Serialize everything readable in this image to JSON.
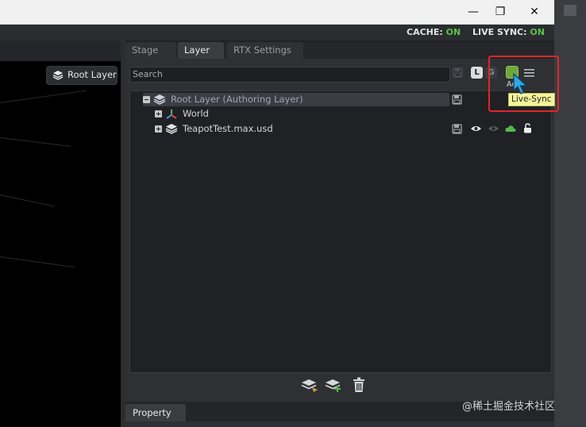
{
  "window": {
    "minimize": "—",
    "restore": "❐",
    "close": "✕"
  },
  "status": {
    "cache_label": "CACHE:",
    "cache_value": "ON",
    "livesync_label": "LIVE SYNC:",
    "livesync_value": "ON"
  },
  "viewport": {
    "root_layer_label": "Root Layer"
  },
  "tabs": [
    {
      "label": "Stage"
    },
    {
      "label": "Layer"
    },
    {
      "label": "RTX Settings"
    }
  ],
  "search": {
    "placeholder": "Search",
    "value": ""
  },
  "toolbar": {
    "local_label": "L",
    "global_label": "G",
    "tooltip_hint": "Ac",
    "tooltip": "Live-Sync"
  },
  "tree": [
    {
      "label": "Root Layer (Authoring Layer)",
      "expanded": true,
      "icon": "layers-icon",
      "selected": true
    },
    {
      "label": "World",
      "expanded": false,
      "icon": "xform-icon"
    },
    {
      "label": "TeapotTest.max.usd",
      "expanded": false,
      "icon": "layers-icon"
    }
  ],
  "property": {
    "tab_label": "Property"
  },
  "watermark": "@稀土掘金技术社区",
  "colors": {
    "live_green": "#57b84a",
    "highlight_red": "#e0262a",
    "tooltip_yellow": "#f4f59a",
    "cursor_blue": "#2fa8e6"
  }
}
